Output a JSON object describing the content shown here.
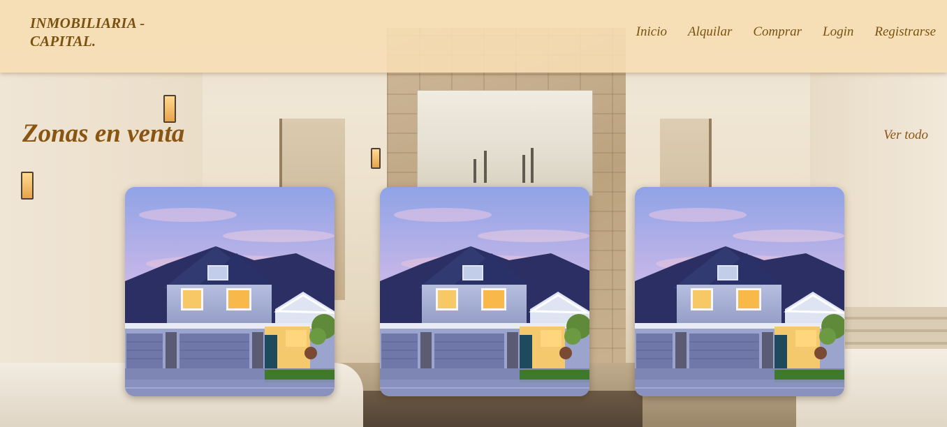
{
  "header": {
    "brand_line1": "INMOBILIARIA -",
    "brand_line2": "CAPITAL.",
    "nav": [
      {
        "label": "Inicio"
      },
      {
        "label": "Alquilar"
      },
      {
        "label": "Comprar"
      },
      {
        "label": "Login"
      },
      {
        "label": "Registrarse"
      }
    ]
  },
  "section": {
    "title": "Zonas en venta",
    "see_all_label": "Ver todo"
  },
  "cards": [
    {
      "image": "house-photo"
    },
    {
      "image": "house-photo"
    },
    {
      "image": "house-photo"
    }
  ],
  "colors": {
    "header_bg": "#f7deb4",
    "accent_text": "#7a5210",
    "title_text": "#8a5510"
  }
}
